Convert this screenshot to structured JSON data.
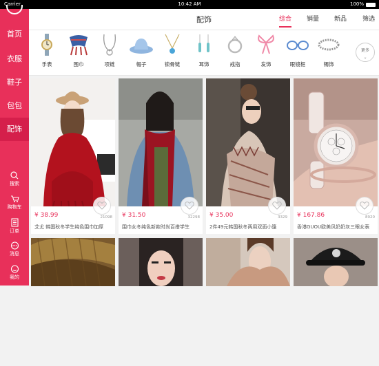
{
  "status_bar": {
    "carrier": "Carrier",
    "time": "10:42 AM",
    "battery": "100%"
  },
  "sidebar": {
    "categories": [
      {
        "label": "首页",
        "active": false
      },
      {
        "label": "衣服",
        "active": false
      },
      {
        "label": "鞋子",
        "active": false
      },
      {
        "label": "包包",
        "active": false
      },
      {
        "label": "配饰",
        "active": true
      }
    ],
    "actions": [
      {
        "label": "搜索",
        "icon": "search-icon"
      },
      {
        "label": "购物车",
        "icon": "cart-icon"
      },
      {
        "label": "订单",
        "icon": "order-icon"
      },
      {
        "label": "消息",
        "icon": "message-icon"
      },
      {
        "label": "我的",
        "icon": "profile-icon"
      }
    ]
  },
  "header": {
    "title": "配饰",
    "sort_tabs": [
      {
        "label": "综合",
        "active": true
      },
      {
        "label": "销量",
        "active": false
      },
      {
        "label": "新品",
        "active": false
      },
      {
        "label": "筛选",
        "active": false
      }
    ]
  },
  "categories": {
    "items": [
      {
        "label": "手表",
        "icon": "watch-icon"
      },
      {
        "label": "围巾",
        "icon": "scarf-icon"
      },
      {
        "label": "项链",
        "icon": "necklace-icon"
      },
      {
        "label": "帽子",
        "icon": "hat-icon"
      },
      {
        "label": "锁骨链",
        "icon": "pendant-icon"
      },
      {
        "label": "耳饰",
        "icon": "earring-icon"
      },
      {
        "label": "戒指",
        "icon": "ring-icon"
      },
      {
        "label": "发饰",
        "icon": "hair-bow-icon"
      },
      {
        "label": "眼镜框",
        "icon": "glasses-icon"
      },
      {
        "label": "镯饰",
        "icon": "bracelet-icon"
      }
    ],
    "more_label": "更多"
  },
  "products": [
    {
      "price": "¥ 38.99",
      "likes": "21098",
      "title": "艾尤 韩国秋冬学生纯色围巾加厚",
      "image": "woman-red-scarf-hat"
    },
    {
      "price": "¥ 31.50",
      "likes": "32298",
      "title": "围巾女冬纯色新款时尚百搭学生",
      "image": "woman-red-scarf-denim"
    },
    {
      "price": "¥ 35.00",
      "likes": "3329",
      "title": "2件49元韩国秋冬两用双面小篷",
      "image": "woman-pattern-scarf"
    },
    {
      "price": "¥ 167.86",
      "likes": "8920",
      "title": "香港GUOU欧美风奶奶灰三眼女表",
      "image": "wrist-watch"
    },
    {
      "price": "",
      "likes": "",
      "title": "",
      "image": "knit-scarf"
    },
    {
      "price": "",
      "likes": "",
      "title": "",
      "image": "woman-portrait"
    },
    {
      "price": "",
      "likes": "",
      "title": "",
      "image": "woman-beige-scarf"
    },
    {
      "price": "",
      "likes": "",
      "title": "",
      "image": "woman-black-cap"
    }
  ],
  "colors": {
    "accent": "#e8305a",
    "sidebar_active": "#d51f4b",
    "background": "#f2f2f2"
  }
}
